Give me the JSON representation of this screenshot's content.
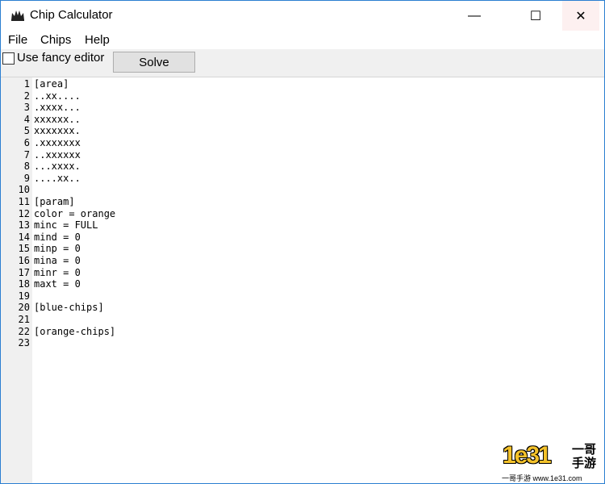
{
  "window": {
    "title": "Chip Calculator",
    "app_icon": "crown-icon"
  },
  "controls": {
    "minimize": "—",
    "maximize": "☐",
    "close": "✕"
  },
  "menu": {
    "items": [
      "File",
      "Chips",
      "Help"
    ]
  },
  "toolbar": {
    "checkbox_label": "Use fancy editor",
    "checkbox_checked": false,
    "solve_label": "Solve"
  },
  "editor": {
    "line_numbers": [
      "1",
      "2",
      "3",
      "4",
      "5",
      "6",
      "7",
      "8",
      "9",
      "10",
      "11",
      "12",
      "13",
      "14",
      "15",
      "16",
      "17",
      "18",
      "19",
      "20",
      "21",
      "22",
      "23"
    ],
    "lines": [
      "[area]",
      "..xx....",
      ".xxxx...",
      "xxxxxx..",
      "xxxxxxx.",
      ".xxxxxxx",
      "..xxxxxx",
      "...xxxx.",
      "....xx..",
      "",
      "[param]",
      "color = orange",
      "minc = FULL",
      "mind = 0",
      "minp = 0",
      "mina = 0",
      "minr = 0",
      "maxt = 0",
      "",
      "[blue-chips]",
      "",
      "[orange-chips]",
      ""
    ]
  },
  "watermark": {
    "logo_number": "1e31",
    "logo_chars": "一哥手游",
    "site_text": "一哥手游 www.1e31.com"
  }
}
